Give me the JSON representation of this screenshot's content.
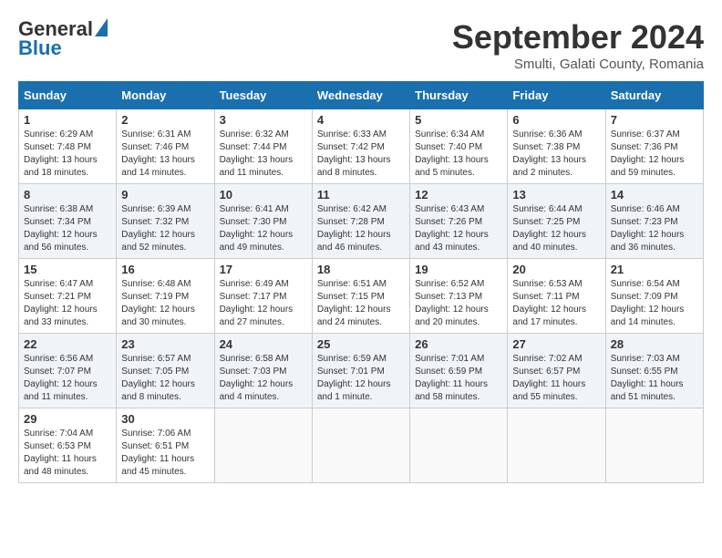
{
  "header": {
    "logo_line1": "General",
    "logo_line2": "Blue",
    "month_title": "September 2024",
    "location": "Smulti, Galati County, Romania"
  },
  "weekdays": [
    "Sunday",
    "Monday",
    "Tuesday",
    "Wednesday",
    "Thursday",
    "Friday",
    "Saturday"
  ],
  "weeks": [
    [
      {
        "day": "1",
        "sunrise": "6:29 AM",
        "sunset": "7:48 PM",
        "daylight": "13 hours and 18 minutes."
      },
      {
        "day": "2",
        "sunrise": "6:31 AM",
        "sunset": "7:46 PM",
        "daylight": "13 hours and 14 minutes."
      },
      {
        "day": "3",
        "sunrise": "6:32 AM",
        "sunset": "7:44 PM",
        "daylight": "13 hours and 11 minutes."
      },
      {
        "day": "4",
        "sunrise": "6:33 AM",
        "sunset": "7:42 PM",
        "daylight": "13 hours and 8 minutes."
      },
      {
        "day": "5",
        "sunrise": "6:34 AM",
        "sunset": "7:40 PM",
        "daylight": "13 hours and 5 minutes."
      },
      {
        "day": "6",
        "sunrise": "6:36 AM",
        "sunset": "7:38 PM",
        "daylight": "13 hours and 2 minutes."
      },
      {
        "day": "7",
        "sunrise": "6:37 AM",
        "sunset": "7:36 PM",
        "daylight": "12 hours and 59 minutes."
      }
    ],
    [
      {
        "day": "8",
        "sunrise": "6:38 AM",
        "sunset": "7:34 PM",
        "daylight": "12 hours and 56 minutes."
      },
      {
        "day": "9",
        "sunrise": "6:39 AM",
        "sunset": "7:32 PM",
        "daylight": "12 hours and 52 minutes."
      },
      {
        "day": "10",
        "sunrise": "6:41 AM",
        "sunset": "7:30 PM",
        "daylight": "12 hours and 49 minutes."
      },
      {
        "day": "11",
        "sunrise": "6:42 AM",
        "sunset": "7:28 PM",
        "daylight": "12 hours and 46 minutes."
      },
      {
        "day": "12",
        "sunrise": "6:43 AM",
        "sunset": "7:26 PM",
        "daylight": "12 hours and 43 minutes."
      },
      {
        "day": "13",
        "sunrise": "6:44 AM",
        "sunset": "7:25 PM",
        "daylight": "12 hours and 40 minutes."
      },
      {
        "day": "14",
        "sunrise": "6:46 AM",
        "sunset": "7:23 PM",
        "daylight": "12 hours and 36 minutes."
      }
    ],
    [
      {
        "day": "15",
        "sunrise": "6:47 AM",
        "sunset": "7:21 PM",
        "daylight": "12 hours and 33 minutes."
      },
      {
        "day": "16",
        "sunrise": "6:48 AM",
        "sunset": "7:19 PM",
        "daylight": "12 hours and 30 minutes."
      },
      {
        "day": "17",
        "sunrise": "6:49 AM",
        "sunset": "7:17 PM",
        "daylight": "12 hours and 27 minutes."
      },
      {
        "day": "18",
        "sunrise": "6:51 AM",
        "sunset": "7:15 PM",
        "daylight": "12 hours and 24 minutes."
      },
      {
        "day": "19",
        "sunrise": "6:52 AM",
        "sunset": "7:13 PM",
        "daylight": "12 hours and 20 minutes."
      },
      {
        "day": "20",
        "sunrise": "6:53 AM",
        "sunset": "7:11 PM",
        "daylight": "12 hours and 17 minutes."
      },
      {
        "day": "21",
        "sunrise": "6:54 AM",
        "sunset": "7:09 PM",
        "daylight": "12 hours and 14 minutes."
      }
    ],
    [
      {
        "day": "22",
        "sunrise": "6:56 AM",
        "sunset": "7:07 PM",
        "daylight": "12 hours and 11 minutes."
      },
      {
        "day": "23",
        "sunrise": "6:57 AM",
        "sunset": "7:05 PM",
        "daylight": "12 hours and 8 minutes."
      },
      {
        "day": "24",
        "sunrise": "6:58 AM",
        "sunset": "7:03 PM",
        "daylight": "12 hours and 4 minutes."
      },
      {
        "day": "25",
        "sunrise": "6:59 AM",
        "sunset": "7:01 PM",
        "daylight": "12 hours and 1 minute."
      },
      {
        "day": "26",
        "sunrise": "7:01 AM",
        "sunset": "6:59 PM",
        "daylight": "11 hours and 58 minutes."
      },
      {
        "day": "27",
        "sunrise": "7:02 AM",
        "sunset": "6:57 PM",
        "daylight": "11 hours and 55 minutes."
      },
      {
        "day": "28",
        "sunrise": "7:03 AM",
        "sunset": "6:55 PM",
        "daylight": "11 hours and 51 minutes."
      }
    ],
    [
      {
        "day": "29",
        "sunrise": "7:04 AM",
        "sunset": "6:53 PM",
        "daylight": "11 hours and 48 minutes."
      },
      {
        "day": "30",
        "sunrise": "7:06 AM",
        "sunset": "6:51 PM",
        "daylight": "11 hours and 45 minutes."
      },
      null,
      null,
      null,
      null,
      null
    ]
  ]
}
